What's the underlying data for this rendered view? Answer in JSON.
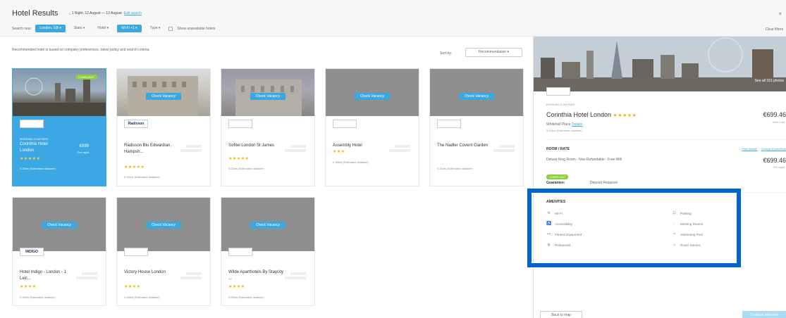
{
  "header": {
    "title": "Hotel Results",
    "stay": "1 Night, 12 August — 13 August",
    "edit_link": "Edit search",
    "close": "×"
  },
  "filters": {
    "search_near_label": "Search near",
    "location": "London, GB",
    "stars": "Stars",
    "hotel": "Hotel",
    "wifi": "Wi-Fi +1",
    "type": "Type",
    "show_unavailable": "Show unavailable hotels",
    "clear": "Clear filters"
  },
  "results": {
    "info": "Recommended hotel is based on company preferences, travel policy and search criteria.",
    "sort_label": "Sort by:",
    "sort_value": "Recommendation",
    "check_vacancy": "Check Vacancy",
    "hotels": [
      {
        "name": "Corinthia Hotel London",
        "stars": "★★★★★",
        "distance": "0.23km (Estimated distance)",
        "price": "€699",
        "per_night": "Per night",
        "badge": "COMPLIANT",
        "booking_rate": "BOOKING.COM RATE",
        "logo": ""
      },
      {
        "name": "Radisson Blu Edwardian, Hampsh...",
        "stars": "★★★★★",
        "distance": "0.32km (Estimated distance)",
        "logo": "Radisson"
      },
      {
        "name": "Sofitel London St James",
        "stars": "★★★★★",
        "distance": "0.03km (Estimated distance)",
        "logo": ""
      },
      {
        "name": "Assembly Hotel",
        "stars": "★★★",
        "distance": "0.36km (Estimated distance)",
        "logo": ""
      },
      {
        "name": "The Nadler Covent Garden",
        "stars": "",
        "distance": "0.41km (Estimated distance)",
        "logo": ""
      },
      {
        "name": "Hotel Indigo - London - 1 Leic...",
        "stars": "★★★★",
        "distance": "0.42km (Estimated distance)",
        "logo": "INDIGO"
      },
      {
        "name": "Victory House London",
        "stars": "★★★★",
        "distance": "0.46km (Estimated distance)",
        "logo": ""
      },
      {
        "name": "Wilde Aparthotels By Staycity ...",
        "stars": "★★★★",
        "distance": "0.00km (Estimated distance)",
        "logo": ""
      }
    ]
  },
  "detail": {
    "photos": "See all 161 photos",
    "booking_rate": "BOOKING.COM RATE",
    "name": "Corinthia Hotel London",
    "stars": "★★★★★",
    "price": "€699.46",
    "total": "Total Cost",
    "address": "Whitehall Place",
    "details_link": "Details",
    "distance": "0.23km (Estimated distance)",
    "room_rate_title": "ROOM / RATE",
    "rate_details": "Rate details",
    "change_room": "Change Room/Rate",
    "room_desc": "Deluxe King Room - Non-Refundable - Free Wifi",
    "room_price": "€699.46",
    "per_night": "Per night",
    "compliant": "COMPLIANT",
    "guarantee_label": "Guarantee:",
    "guarantee_value": "Deposit Required",
    "amenities_title": "AMENITIES",
    "amenities": [
      {
        "label": "Wi-Fi",
        "icon": "wifi-icon"
      },
      {
        "label": "Parking",
        "icon": "parking-icon"
      },
      {
        "label": "Accessibility",
        "icon": "accessibility-icon"
      },
      {
        "label": "Meeting Rooms",
        "icon": "meeting-rooms-icon"
      },
      {
        "label": "Fitness Equipment",
        "icon": "fitness-icon"
      },
      {
        "label": "Swimming Pool",
        "icon": "swimming-pool-icon"
      },
      {
        "label": "Restaurant",
        "icon": "restaurant-icon"
      },
      {
        "label": "Room Service",
        "icon": "room-service-icon"
      }
    ],
    "back_to_map": "Back to map",
    "continue": "Continue selection"
  },
  "colors": {
    "accent": "#3aa7dd",
    "selected_card": "#3ba7e5",
    "compliant": "#8bd13c",
    "highlight": "#0066cc",
    "star": "#f5b300"
  }
}
